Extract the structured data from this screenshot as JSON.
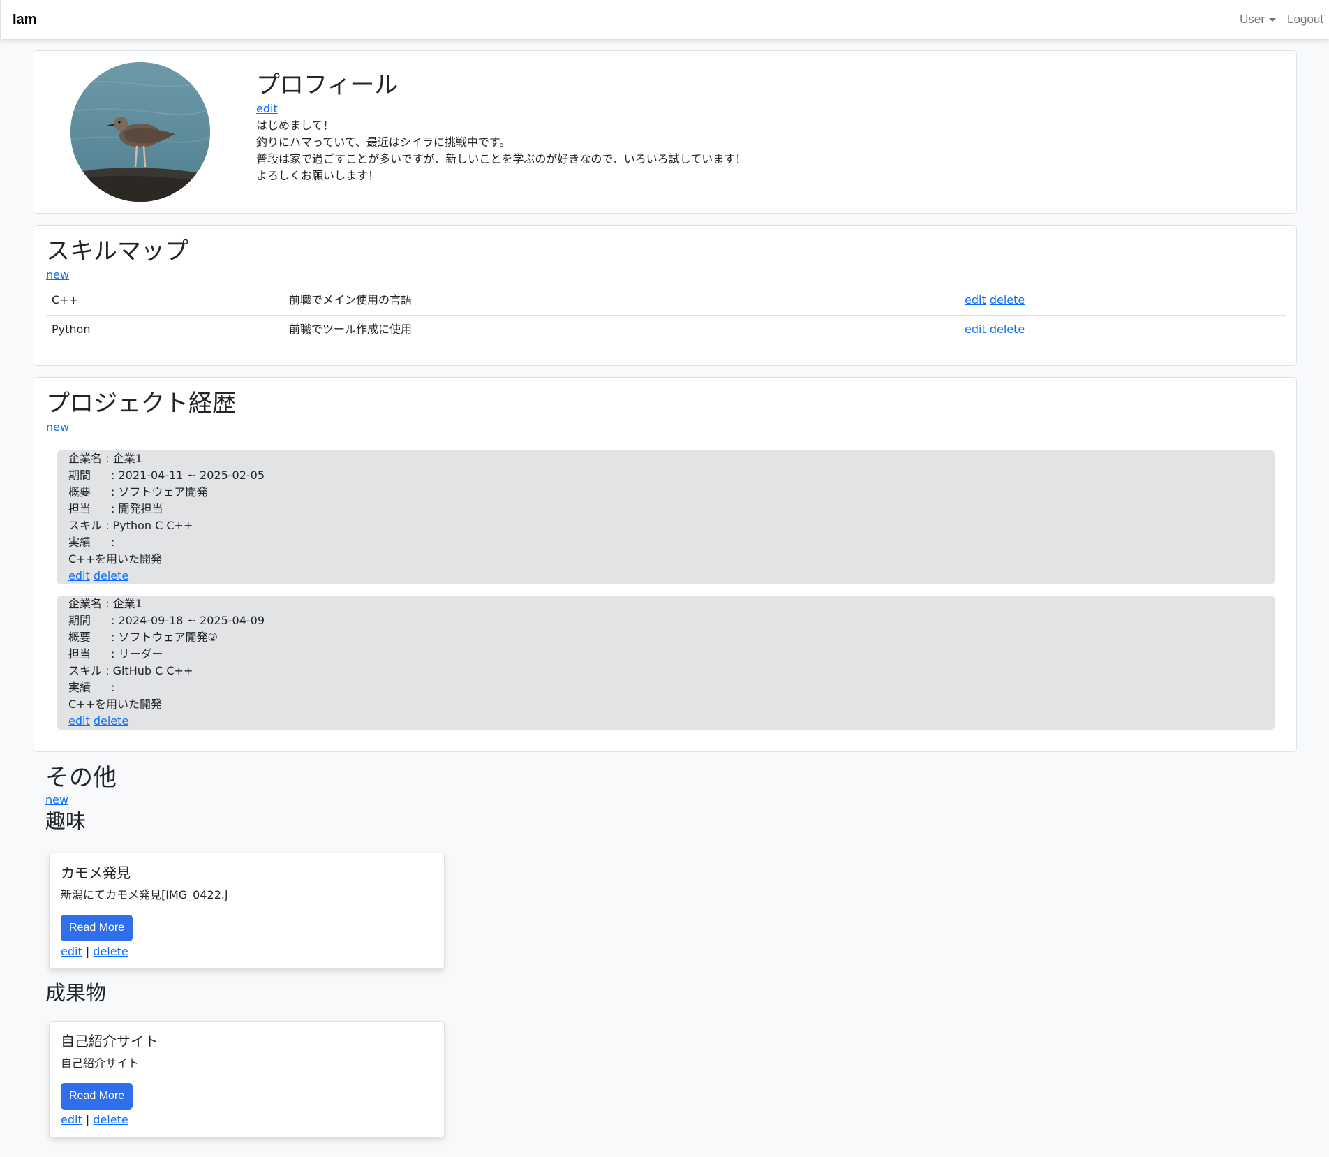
{
  "navbar": {
    "brand": "Iam",
    "user_label": "User",
    "logout_label": "Logout"
  },
  "profile": {
    "title": "プロフィール",
    "edit_label": "edit",
    "bio": [
      "はじめまして！",
      "釣りにハマっていて、最近はシイラに挑戦中です。",
      "普段は家で過ごすことが多いですが、新しいことを学ぶのが好きなので、いろいろ試しています！",
      "よろしくお願いします！"
    ]
  },
  "skills": {
    "title": "スキルマップ",
    "new_label": "new",
    "rows": [
      {
        "name": "C++",
        "description": "前職でメイン使用の言語",
        "edit": "edit",
        "delete": "delete"
      },
      {
        "name": "Python",
        "description": "前職でツール作成に使用",
        "edit": "edit",
        "delete": "delete"
      }
    ]
  },
  "projects": {
    "title": "プロジェクト経歴",
    "new_label": "new",
    "items": [
      {
        "company_label": "企業名 : ",
        "company": "企業1",
        "period_label": "期間",
        "period": ": 2021-04-11 ~ 2025-02-05",
        "summary_label": "概要",
        "summary": ": ソフトウェア開発",
        "role_label": "担当",
        "role": ": 開発担当",
        "skills_label": "スキル : ",
        "skills": "Python C C++",
        "result_label": "実績",
        "result": ":",
        "detail": "C++を用いた開発",
        "edit": "edit",
        "delete": "delete"
      },
      {
        "company_label": "企業名 : ",
        "company": "企業1",
        "period_label": "期間",
        "period": ": 2024-09-18 ~ 2025-04-09",
        "summary_label": "概要",
        "summary": ": ソフトウェア開発②",
        "role_label": "担当",
        "role": ": リーダー",
        "skills_label": "スキル : ",
        "skills": "GitHub C C++",
        "result_label": "実績",
        "result": ":",
        "detail": "C++を用いた開発",
        "edit": "edit",
        "delete": "delete"
      }
    ]
  },
  "other": {
    "title": "その他",
    "new_label": "new",
    "hobby": {
      "heading": "趣味",
      "card_title": "カモメ発見",
      "card_desc": "新潟にてカモメ発見[IMG_0422.j",
      "button": "Read More",
      "edit": "edit",
      "separator": "|",
      "delete": "delete"
    },
    "works": {
      "heading": "成果物",
      "card_title": "自己紹介サイト",
      "card_desc": "自己紹介サイト",
      "button": "Read More",
      "edit": "edit",
      "separator": "|",
      "delete": "delete"
    }
  },
  "colors": {
    "link": "#0d6efd",
    "button": "#2f6fec",
    "project_box": "#e2e3e5",
    "page_bg": "#f8f9fa"
  }
}
